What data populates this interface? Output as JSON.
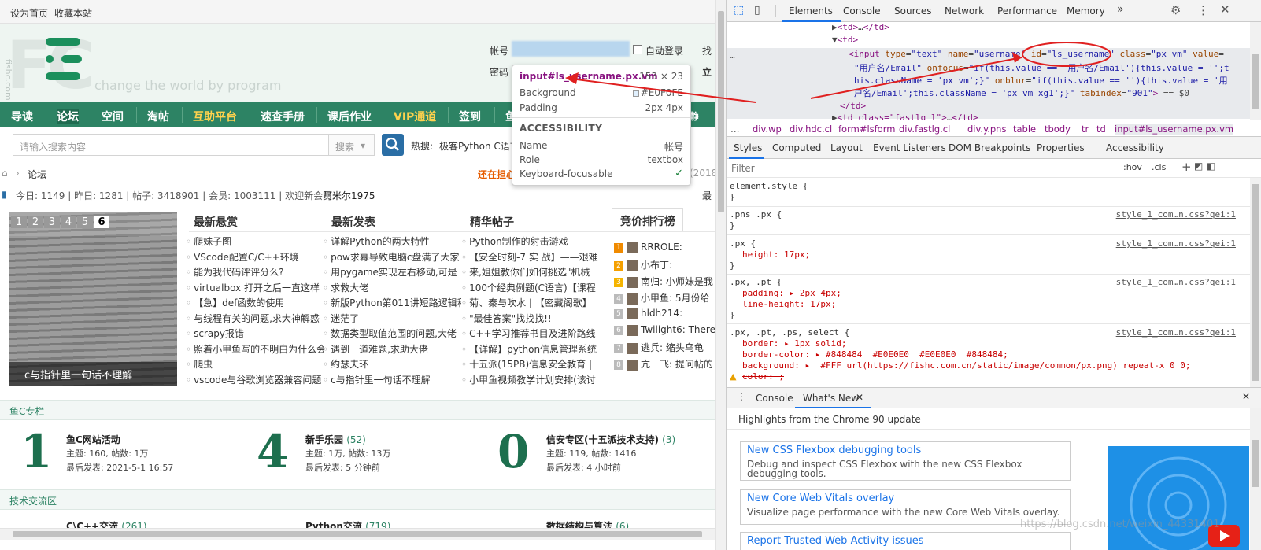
{
  "site": {
    "topbar": {
      "set_home": "设为首页",
      "bookmark": "收藏本站"
    },
    "logo": {
      "letters": "FC",
      "vertical": "fishc.com",
      "slogan": "change the world by program"
    },
    "login": {
      "account_label": "帐号",
      "password_label": "密码",
      "auto_login": "自动登录",
      "find_label": "找",
      "login_button": "立"
    },
    "nav": [
      "导读",
      "论坛",
      "空间",
      "淘帖",
      "互助平台",
      "速查手册",
      "课后作业",
      "VIP通道",
      "签到",
      "鱼"
    ],
    "nav_right": "静",
    "search": {
      "placeholder": "请输入搜索内容",
      "scope": "搜索",
      "hot_label": "热搜:",
      "hot_items": "极客Python C语言"
    },
    "breadcrumb": {
      "current": "论坛",
      "notice": "还在担心",
      "notice_tail": "(2018"
    },
    "stats": {
      "text": "今日: 1149 | 昨日: 1281 | 帖子: 3418901 | 会员: 1003111 | 欢迎新会员:",
      "new_member": "阿米尔1975",
      "tail": "最"
    },
    "slider": {
      "pages": [
        "1",
        "2",
        "3",
        "4",
        "5",
        "6"
      ],
      "caption": "c与指针里一句话不理解"
    },
    "panels": {
      "latest_reply": {
        "title": "最新悬赏",
        "items": [
          "爬妹子图",
          "VScode配置C/C++环境",
          "能为我代码评评分么?",
          "virtualbox 打开之后一直这样",
          "【急】def函数的使用",
          "与线程有关的问题,求大神解惑",
          "scrapy报错",
          "照着小甲鱼写的不明白为什么会",
          "爬虫",
          "vscode与谷歌浏览器兼容问题"
        ]
      },
      "latest_post": {
        "title": "最新发表",
        "items": [
          "详解Python的两大特性",
          "pow求幂导致电脑c盘满了大家",
          "用pygame实现左右移动,可是",
          "求救大佬",
          "新版Python第011讲短路逻辑和",
          "迷茫了",
          "数据类型取值范围的问题,大佬",
          "遇到一道难题,求助大佬",
          "约瑟夫环",
          "c与指针里一句话不理解"
        ]
      },
      "essence": {
        "title": "精华帖子",
        "items": [
          "Python制作的射击游戏",
          "【安全时刻-7 实 战】——艰难",
          "来,姐姐教你们如何挑选\"机械",
          "100个经典例题(C语言)【课程",
          "菊、秦与吹水 | 【密藏阁歌】",
          "\"最佳答案\"找找找!!",
          "C++学习推荐书目及进阶路线",
          "【详解】python信息管理系统",
          "十五派(15PB)信息安全教育 |",
          "小甲鱼视频教学计划安排(该讨"
        ]
      },
      "ranking": {
        "title": "竞价排行榜",
        "items": [
          "RRROLE:",
          "小布丁:",
          "南归: 小师妹是我",
          "小甲鱼: 5月份给",
          "hldh214:",
          "Twilight6: There",
          "逃兵: 缩头乌龟",
          "亢一飞: 提问帖的"
        ]
      }
    },
    "sections": [
      {
        "title": "鱼C专栏",
        "forums": [
          {
            "num": "1",
            "name": "鱼C网站活动",
            "count": "",
            "topics": "主题: 160, 帖数: 1万",
            "last": "最后发表: 2021-5-1 16:57"
          },
          {
            "num": "4",
            "name": "新手乐园",
            "count": "(52)",
            "topics": "主题: 1万, 帖数: 13万",
            "last": "最后发表: 5 分钟前"
          },
          {
            "num": "0",
            "name": "信安专区(十五派技术支持)",
            "count": "(3)",
            "topics": "主题: 119, 帖数: 1416",
            "last": "最后发表: 4 小时前"
          }
        ]
      },
      {
        "title": "技术交流区",
        "forums": [
          {
            "name": "C\\C++交流",
            "count": "(261)"
          },
          {
            "name": "Python交流",
            "count": "(719)"
          },
          {
            "name": "数据结构与算法",
            "count": "(6)"
          }
        ]
      }
    ]
  },
  "tooltip": {
    "selector": "input#ls_username.px.vm",
    "size": "153 × 23",
    "background_label": "Background",
    "background_value": "#E0F0FE",
    "padding_label": "Padding",
    "padding_value": "2px 4px",
    "accessibility": "ACCESSIBILITY",
    "name_label": "Name",
    "name_value": "帐号",
    "role_label": "Role",
    "role_value": "textbox",
    "focus_label": "Keyboard-focusable"
  },
  "devtools": {
    "tabs": [
      "Elements",
      "Console",
      "Sources",
      "Network",
      "Performance",
      "Memory"
    ],
    "more": "»",
    "breadcrumbs": [
      "div.wp",
      "div.hdc.cl",
      "form#lsform",
      "div.fastlg.cl",
      "div.y.pns",
      "table",
      "tbody",
      "tr",
      "td",
      "input#ls_username.px.vm"
    ],
    "style_tabs": [
      "Styles",
      "Computed",
      "Layout",
      "Event Listeners",
      "DOM Breakpoints",
      "Properties",
      "Accessibility"
    ],
    "filter_placeholder": "Filter",
    "hov": ":hov",
    "cls": ".cls",
    "rules": [
      {
        "selector": "element.style {",
        "link": ""
      },
      {
        "selector": ".pns .px {",
        "link": "style_1_com…n.css?qei:1"
      },
      {
        "selector": ".px {",
        "link": "style_1_com…n.css?qei:1",
        "decl": "height: 17px;"
      },
      {
        "selector": ".px, .pt {",
        "link": "style_1_com…n.css?qei:1",
        "decl": "padding: ▸ 2px 4px;",
        "decl2": "line-height: 17px;"
      },
      {
        "selector": ".px, .pt, .ps, select {",
        "link": "style_1_com…n.css?qei:1",
        "decl": "border: ▸ 1px solid;",
        "decl2": "border-color: ▸ #848484  #E0E0E0  #E0E0E0  #848484;",
        "decl3": "background: ▸  #FFF url(https://fishc.com.cn/static/image/common/px.png) repeat-x 0 0;",
        "decl4": "color: ;"
      }
    ],
    "drawer": {
      "tabs": [
        "Console",
        "What's New"
      ],
      "headline": "Highlights from the Chrome 90 update",
      "cards": [
        {
          "title": "New CSS Flexbox debugging tools",
          "desc": "Debug and inspect CSS Flexbox with the new CSS Flexbox debugging tools."
        },
        {
          "title": "New Core Web Vitals overlay",
          "desc": "Visualize page performance with the new Core Web Vitals overlay."
        },
        {
          "title": "Report Trusted Web Activity issues",
          "desc": ""
        }
      ]
    },
    "watermark": "https://blog.csdn.net/weixin_44331401"
  },
  "colors": {
    "nav": "#2d8364",
    "accent": "#1a73e8",
    "annotation": "#e02020"
  }
}
